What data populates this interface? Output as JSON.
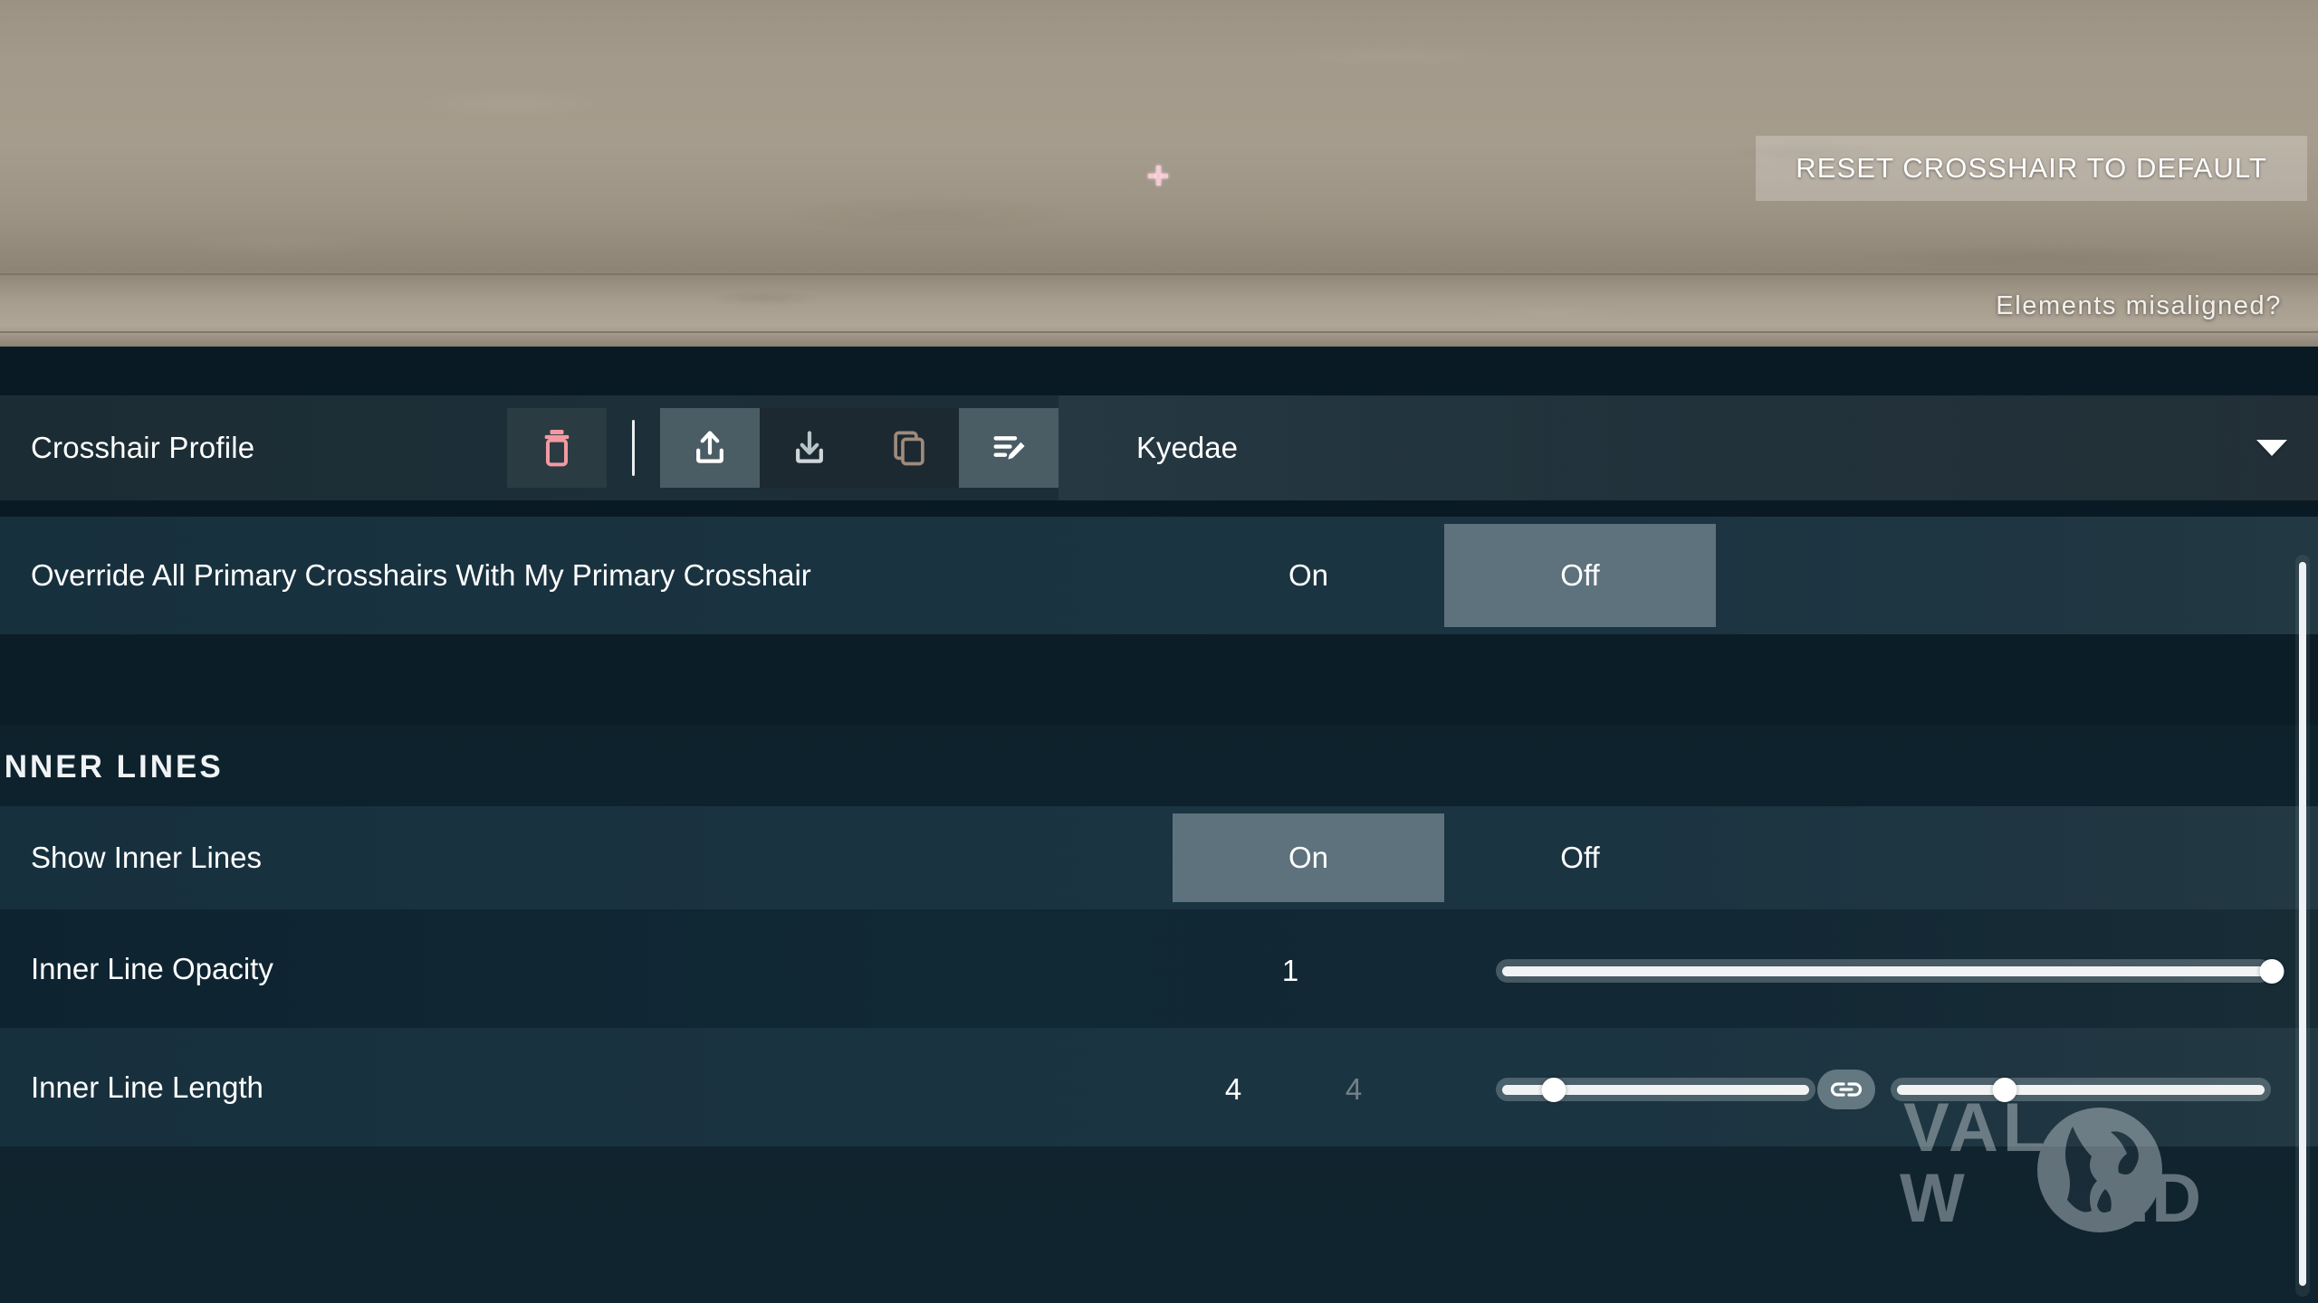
{
  "preview": {
    "reset_button_label": "RESET CROSSHAIR TO DEFAULT",
    "misaligned_link_label": "Elements misaligned?",
    "crosshair_color": "#f5c9d6"
  },
  "profile_row": {
    "label": "Crosshair Profile",
    "selected_profile": "Kyedae",
    "icons": {
      "delete": "trash-icon",
      "export": "upload-icon",
      "import": "download-icon",
      "duplicate": "copy-icon",
      "rename": "rename-icon",
      "dropdown": "chevron-down-icon"
    },
    "colors": {
      "delete_icon": "#f29aa3",
      "export_icon": "#ffffff",
      "import_icon": "#b9c4ca",
      "duplicate_icon": "#9d8b7c",
      "rename_icon": "#ffffff"
    }
  },
  "settings": {
    "override": {
      "label": "Override All Primary Crosshairs With My Primary Crosshair",
      "options": [
        "On",
        "Off"
      ],
      "selected": "Off"
    },
    "section_inner_lines": "INNER LINES",
    "show_inner_lines": {
      "label": "Show Inner Lines",
      "options": [
        "On",
        "Off"
      ],
      "selected": "On"
    },
    "inner_line_opacity": {
      "label": "Inner Line Opacity",
      "value": "1",
      "slider_percent": 100
    },
    "inner_line_length": {
      "label": "Inner Line Length",
      "value": "4",
      "value_secondary": "4",
      "slider_a_percent": 18,
      "slider_b_percent": 30,
      "link_icon": "link-icon"
    }
  },
  "watermark": {
    "line1": "VAL",
    "line2": "W",
    "line3": "LD"
  }
}
